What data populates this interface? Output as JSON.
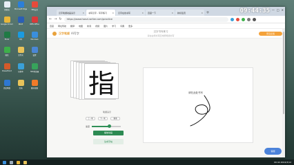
{
  "desktop": {
    "icons": [
      {
        "label": "回收站",
        "color": "#e7eef5"
      },
      {
        "label": "Microsoft Edge",
        "color": "#2b7fd8"
      },
      {
        "label": "360安全",
        "color": "#e64a3b"
      },
      {
        "label": "Google Chrome",
        "color": "#e8b73a"
      },
      {
        "label": "Word",
        "color": "#2b5fb5"
      },
      {
        "label": "WPS Office",
        "color": "#d93a3a"
      },
      {
        "label": "Excel",
        "color": "#1f7a44"
      },
      {
        "label": "QQ",
        "color": "#1a9be0"
      },
      {
        "label": "Windows",
        "color": "#3a8fdc"
      },
      {
        "label": "微信",
        "color": "#3db04a"
      },
      {
        "label": "文件夹",
        "color": "#e8c35a"
      },
      {
        "label": "设置",
        "color": "#4a87d6"
      },
      {
        "label": "PowerPoint",
        "color": "#d35a2a"
      },
      {
        "label": "记事本",
        "color": "#3aa0d8"
      },
      {
        "label": "360浏览器",
        "color": "#37a35b"
      },
      {
        "label": "百度网盘",
        "color": "#2e77d0"
      },
      {
        "label": "文档",
        "color": "#e8c35a"
      },
      {
        "label": "腾讯视频",
        "color": "#f07b2a"
      }
    ]
  },
  "browser": {
    "tabs": [
      {
        "label": "汉字笔顺动画演示",
        "active": false
      },
      {
        "label": "书写汉字 - 写字练习",
        "active": true
      },
      {
        "label": "汉字在线书写",
        "active": false
      },
      {
        "label": "百度一下",
        "active": false
      },
      {
        "label": "新标签页",
        "active": false
      }
    ],
    "clock": "09:44:35",
    "url": "https://www.hanzi-writer.com/practice",
    "bookmarks": [
      "百度",
      "网址导航",
      "翻译",
      "地图",
      "新闻",
      "视频",
      "图片",
      "学习",
      "词典",
      "更多"
    ]
  },
  "page": {
    "brand": "汉字笔顺",
    "brand_sub": "AI写字",
    "header_title": "汉字书写练习",
    "header_sub": "请在右侧书写区域按笔顺书写",
    "feedback_button": "意见反馈",
    "character": "指",
    "char_label": "笔顺演示",
    "stroke_buttons": [
      "上一笔",
      "下一笔",
      "重播"
    ],
    "speed_label": "速度",
    "speed_value": 0.6,
    "play_button": "播放动画",
    "generate_button": "生成字帖",
    "draw_prompt": "请在此处书写",
    "badge": "客服"
  },
  "taskbar": {
    "tray": "09:44 2024/3/12"
  }
}
